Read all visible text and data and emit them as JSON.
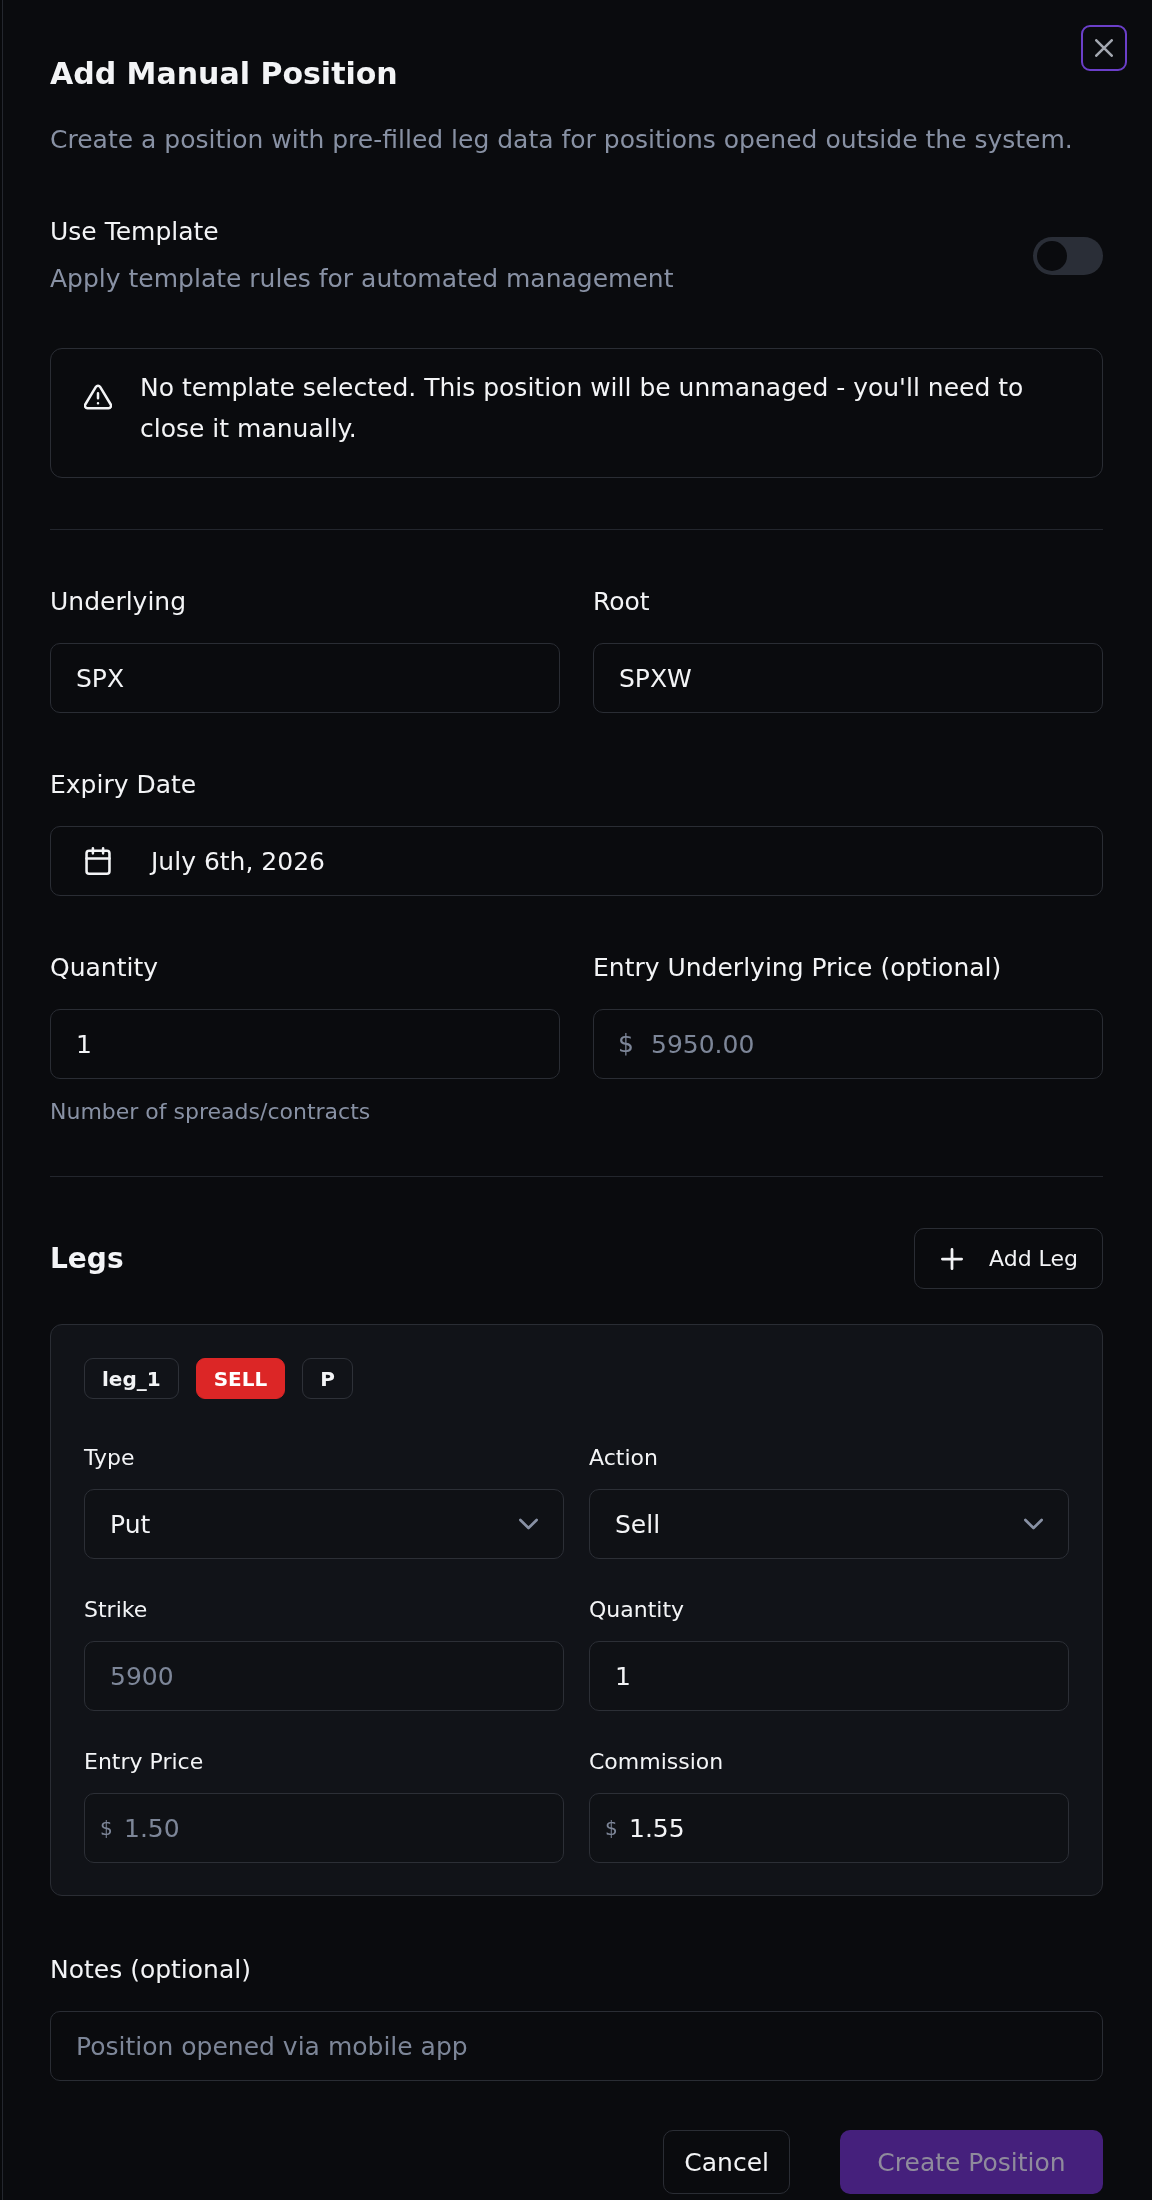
{
  "dialog": {
    "title": "Add Manual Position",
    "description": "Create a position with pre-filled leg data for positions opened outside the system."
  },
  "template": {
    "label": "Use Template",
    "hint": "Apply template rules for automated management",
    "on": false
  },
  "alert": {
    "text": "No template selected. This position will be unmanaged - you'll need to close it manually."
  },
  "fields": [
    {
      "kind": "text",
      "label": "Underlying",
      "value": "SPX"
    },
    {
      "kind": "text",
      "label": "Root",
      "value": "SPXW"
    },
    {
      "kind": "date",
      "label": "Expiry Date",
      "value": "July 6th, 2026"
    },
    {
      "kind": "text",
      "label": "Quantity",
      "value": "1",
      "help": "Number of spreads/contracts"
    },
    {
      "kind": "money",
      "label": "Entry Underlying Price (optional)",
      "prefix": "$",
      "placeholder": "5950.00"
    }
  ],
  "legs": {
    "title": "Legs",
    "add_button": "Add Leg",
    "items": [
      {
        "badges": [
          {
            "kind": "outline",
            "text": "leg_1"
          },
          {
            "kind": "sell",
            "text": "SELL"
          },
          {
            "kind": "outline",
            "text": "P"
          }
        ],
        "fields": [
          {
            "kind": "select",
            "label": "Type",
            "value": "Put"
          },
          {
            "kind": "select",
            "label": "Action",
            "value": "Sell"
          },
          {
            "kind": "text",
            "label": "Strike",
            "placeholder": "5900"
          },
          {
            "kind": "text",
            "label": "Quantity",
            "value": "1"
          },
          {
            "kind": "money",
            "label": "Entry Price",
            "prefix": "$",
            "placeholder": "1.50"
          },
          {
            "kind": "money",
            "label": "Commission",
            "prefix": "$",
            "value": "1.55"
          }
        ]
      }
    ]
  },
  "notes": {
    "label": "Notes (optional)",
    "placeholder": "Position opened via mobile app"
  },
  "footer": {
    "cancel": "Cancel",
    "submit": {
      "label": "Create Position",
      "disabled": true
    }
  }
}
